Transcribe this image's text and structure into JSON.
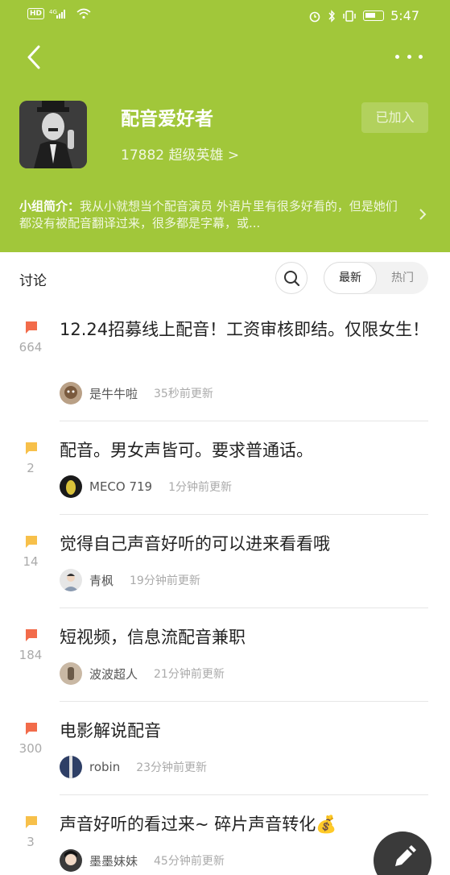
{
  "status_bar": {
    "network": "4G",
    "time": "5:47"
  },
  "group": {
    "name": "配音爱好者",
    "members": "17882 超级英雄 >",
    "join_state": "已加入",
    "intro_label": "小组简介：",
    "intro_text": "我从小就想当个配音演员 外语片里有很多好看的，但是她们都没有被配音翻译过来，很多都是字幕，或..."
  },
  "tabs": {
    "title": "讨论",
    "latest": "最新",
    "hot": "热门"
  },
  "posts": [
    {
      "title": "12.24招募线上配音！工资审核即结。仅限女生！",
      "count": "664",
      "user": "是牛牛啦",
      "time": "35秒前更新",
      "flag_color": "#f26b4a"
    },
    {
      "title": "配音。男女声皆可。要求普通话。",
      "count": "2",
      "user": "MECO 719",
      "time": "1分钟前更新",
      "flag_color": "#f7c04a"
    },
    {
      "title": "觉得自己声音好听的可以进来看看哦",
      "count": "14",
      "user": "青枫",
      "time": "19分钟前更新",
      "flag_color": "#f7c04a"
    },
    {
      "title": "短视频，信息流配音兼职",
      "count": "184",
      "user": "波波超人",
      "time": "21分钟前更新",
      "flag_color": "#f26b4a"
    },
    {
      "title": "电影解说配音",
      "count": "300",
      "user": "robin",
      "time": "23分钟前更新",
      "flag_color": "#f26b4a"
    },
    {
      "title": "声音好听的看过来~ 碎片声音转化💰",
      "count": "3",
      "user": "墨墨妹妹",
      "time": "45分钟前更新",
      "flag_color": "#f7c04a"
    }
  ],
  "colors": {
    "header_bg": "#a1c73a",
    "hot_flag": "#f26b4a",
    "normal_flag": "#f7c04a"
  },
  "icons": {
    "back": "back-arrow-icon",
    "more": "more-icon",
    "search": "search-icon",
    "compose": "pencil-icon"
  }
}
